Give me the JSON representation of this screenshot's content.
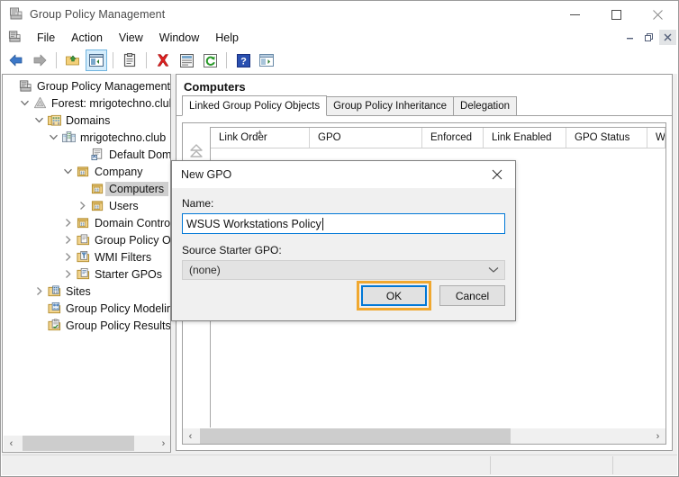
{
  "window": {
    "title": "Group Policy Management",
    "icon": "gpm-console-icon",
    "buttons": {
      "minimize": "−",
      "maximize": "□",
      "close": "✕"
    }
  },
  "menu": {
    "icon": "gpm-console-icon",
    "items": [
      "File",
      "Action",
      "View",
      "Window",
      "Help"
    ],
    "mdi_buttons": {
      "minimize": "─",
      "restore": "❐",
      "close": "✕"
    }
  },
  "toolbar": {
    "items": [
      {
        "name": "back-icon",
        "label": "Back"
      },
      {
        "name": "forward-icon",
        "label": "Forward"
      },
      {
        "name": "up-one-level-icon",
        "label": "Up One Level"
      },
      {
        "name": "show-hide-console-tree-icon",
        "label": "Show/Hide Console Tree",
        "active": true
      },
      {
        "name": "properties-icon",
        "label": "Properties"
      },
      {
        "name": "delete-icon",
        "label": "Delete"
      },
      {
        "name": "report-icon",
        "label": "Report"
      },
      {
        "name": "refresh-icon",
        "label": "Refresh"
      },
      {
        "name": "help-icon",
        "label": "Help"
      },
      {
        "name": "export-list-icon",
        "label": "Export List"
      }
    ]
  },
  "tree": {
    "items": [
      {
        "label": "Group Policy Management",
        "depth": 0,
        "twisty": "",
        "icon": "gpm-console-icon",
        "selected": false
      },
      {
        "label": "Forest: mrigotechno.club",
        "depth": 1,
        "twisty": "expanded",
        "icon": "forest-icon",
        "selected": false
      },
      {
        "label": "Domains",
        "depth": 2,
        "twisty": "expanded",
        "icon": "domains-icon",
        "selected": false
      },
      {
        "label": "mrigotechno.club",
        "depth": 3,
        "twisty": "expanded",
        "icon": "domain-icon",
        "selected": false
      },
      {
        "label": "Default Domain",
        "depth": 5,
        "twisty": "",
        "icon": "gpo-link-icon",
        "selected": false
      },
      {
        "label": "Company",
        "depth": 4,
        "twisty": "expanded",
        "icon": "ou-icon",
        "selected": false
      },
      {
        "label": "Computers",
        "depth": 5,
        "twisty": "",
        "icon": "ou-icon",
        "selected": true
      },
      {
        "label": "Users",
        "depth": 5,
        "twisty": "collapsed",
        "icon": "ou-icon",
        "selected": false
      },
      {
        "label": "Domain Contro",
        "depth": 4,
        "twisty": "collapsed",
        "icon": "ou-icon",
        "selected": false
      },
      {
        "label": "Group Policy Ol",
        "depth": 4,
        "twisty": "collapsed",
        "icon": "gpo-folder-icon",
        "selected": false
      },
      {
        "label": "WMI Filters",
        "depth": 4,
        "twisty": "collapsed",
        "icon": "wmi-filter-icon",
        "selected": false
      },
      {
        "label": "Starter GPOs",
        "depth": 4,
        "twisty": "collapsed",
        "icon": "starter-gpo-icon",
        "selected": false
      },
      {
        "label": "Sites",
        "depth": 2,
        "twisty": "collapsed",
        "icon": "sites-icon",
        "selected": false
      },
      {
        "label": "Group Policy Modeling",
        "depth": 2,
        "twisty": "",
        "icon": "gp-modeling-icon",
        "selected": false
      },
      {
        "label": "Group Policy Results",
        "depth": 2,
        "twisty": "",
        "icon": "gp-results-icon",
        "selected": false
      }
    ]
  },
  "main": {
    "title": "Computers",
    "tabs": [
      {
        "label": "Linked Group Policy Objects",
        "active": true
      },
      {
        "label": "Group Policy Inheritance",
        "active": false
      },
      {
        "label": "Delegation",
        "active": false
      }
    ],
    "columns": [
      {
        "label": "Link Order",
        "width": 110,
        "sorted": true
      },
      {
        "label": "GPO",
        "width": 125,
        "sorted": false
      },
      {
        "label": "Enforced",
        "width": 68,
        "sorted": false
      },
      {
        "label": "Link Enabled",
        "width": 92,
        "sorted": false
      },
      {
        "label": "GPO Status",
        "width": 90,
        "sorted": false
      },
      {
        "label": "W",
        "width": 20,
        "sorted": false
      }
    ],
    "rows": []
  },
  "dialog": {
    "title": "New GPO",
    "close_label": "✕",
    "name_label": "Name:",
    "name_value": "WSUS Workstations Policy",
    "source_label": "Source Starter GPO:",
    "source_value": "(none)",
    "source_caret": "⌄",
    "ok_label": "OK",
    "cancel_label": "Cancel",
    "highlight_color": "#f0a830",
    "focus_color": "#0078d7"
  },
  "scrollbars": {
    "left_arrow": "‹",
    "right_arrow": "›"
  },
  "statusbar": {
    "panes": [
      "",
      "",
      ""
    ]
  }
}
